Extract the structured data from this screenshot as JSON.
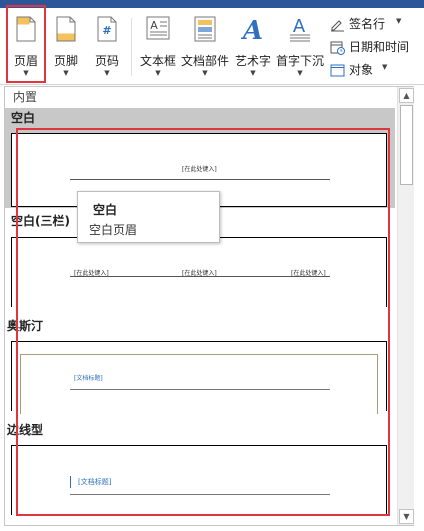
{
  "ribbon": {
    "buttons": [
      {
        "label": "页眉",
        "icon": "header-icon"
      },
      {
        "label": "页脚",
        "icon": "footer-icon"
      },
      {
        "label": "页码",
        "icon": "page-number-icon"
      },
      {
        "label": "文本框",
        "icon": "textbox-icon"
      },
      {
        "label": "文档部件",
        "icon": "quick-parts-icon"
      },
      {
        "label": "艺术字",
        "icon": "wordart-icon"
      },
      {
        "label": "首字下沉",
        "icon": "drop-cap-icon"
      }
    ],
    "small_items": [
      {
        "label": "签名行",
        "icon": "signature-line-icon",
        "has_dropdown": true
      },
      {
        "label": "日期和时间",
        "icon": "date-time-icon",
        "has_dropdown": false
      },
      {
        "label": "对象",
        "icon": "object-icon",
        "has_dropdown": true
      }
    ],
    "page_number_glyph": "#",
    "wordart_glyph": "A",
    "textbox_glyph": "A"
  },
  "gallery": {
    "category": "内置",
    "sections": [
      {
        "title": "空白",
        "placeholders": [
          "[在此处键入]"
        ]
      },
      {
        "title": "空白(三栏)",
        "placeholders": [
          "[在此处键入]",
          "[在此处键入]",
          "[在此处键入]"
        ]
      },
      {
        "title": "奥斯汀",
        "placeholders": [
          "[文档标题]"
        ]
      },
      {
        "title": "边线型",
        "placeholders": [
          "[文档标题]"
        ]
      }
    ]
  },
  "tooltip": {
    "title": "空白",
    "description": "空白页眉"
  },
  "colors": {
    "highlight_red": "#e0353e",
    "selected_gray": "#c8c8c8",
    "title_bar_blue": "#2b579a",
    "austin_border": "#a89f7a",
    "accent_blue": "#2f6fbf"
  }
}
